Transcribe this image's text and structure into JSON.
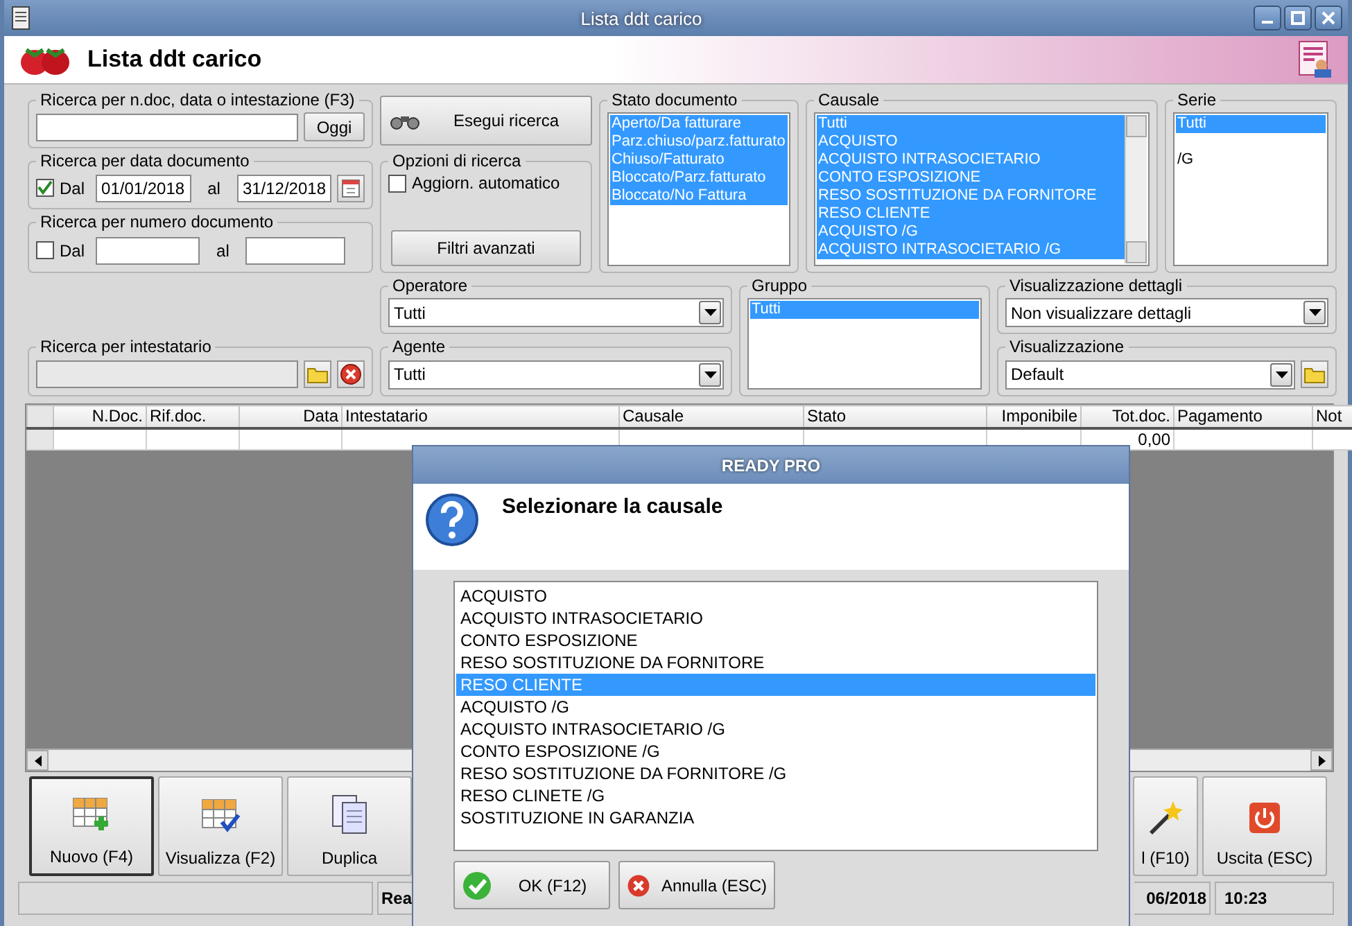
{
  "window": {
    "title": "Lista ddt carico"
  },
  "header": {
    "title": "Lista ddt carico"
  },
  "filters": {
    "search": {
      "legend": "Ricerca per n.doc, data o intestazione (F3)",
      "button": "Oggi"
    },
    "run_button": "Esegui ricerca",
    "date_range": {
      "legend": "Ricerca per data documento",
      "checked": true,
      "from_label": "Dal",
      "from": "01/01/2018",
      "to_label": "al",
      "to": "31/12/2018"
    },
    "number_range": {
      "legend": "Ricerca per numero documento",
      "checked": false,
      "from_label": "Dal",
      "to_label": "al"
    },
    "options": {
      "legend": "Opzioni di ricerca",
      "auto_update": {
        "label": "Aggiorn. automatico",
        "checked": false
      },
      "advanced_button": "Filtri avanzati"
    },
    "stato": {
      "legend": "Stato documento",
      "items": [
        {
          "label": "Aperto/Da fatturare",
          "selected": true
        },
        {
          "label": "Parz.chiuso/parz.fatturato",
          "selected": true
        },
        {
          "label": "Chiuso/Fatturato",
          "selected": true
        },
        {
          "label": "Bloccato/Parz.fatturato",
          "selected": true
        },
        {
          "label": "Bloccato/No Fattura",
          "selected": true
        }
      ]
    },
    "causale": {
      "legend": "Causale",
      "items": [
        {
          "label": "Tutti",
          "selected": true
        },
        {
          "label": "ACQUISTO",
          "selected": true
        },
        {
          "label": "ACQUISTO INTRASOCIETARIO",
          "selected": true
        },
        {
          "label": "CONTO ESPOSIZIONE",
          "selected": true
        },
        {
          "label": "RESO SOSTITUZIONE DA FORNITORE",
          "selected": true
        },
        {
          "label": "RESO CLIENTE",
          "selected": true
        },
        {
          "label": "ACQUISTO /G",
          "selected": true
        },
        {
          "label": "ACQUISTO INTRASOCIETARIO /G",
          "selected": true
        }
      ]
    },
    "serie": {
      "legend": "Serie",
      "items": [
        {
          "label": "Tutti",
          "selected": true
        },
        {
          "label": "/G",
          "selected": false
        }
      ]
    },
    "operatore": {
      "legend": "Operatore",
      "value": "Tutti"
    },
    "gruppo": {
      "legend": "Gruppo",
      "items": [
        {
          "label": "Tutti",
          "selected": true
        }
      ]
    },
    "dettagli": {
      "legend": "Visualizzazione dettagli",
      "value": "Non visualizzare dettagli"
    },
    "intestatario": {
      "legend": "Ricerca per intestatario"
    },
    "agente": {
      "legend": "Agente",
      "value": "Tutti"
    },
    "visualizzazione": {
      "legend": "Visualizzazione",
      "value": "Default"
    }
  },
  "table": {
    "columns": [
      "N.Doc.",
      "Rif.doc.",
      "Data",
      "Intestatario",
      "Causale",
      "Stato",
      "Imponibile",
      "Tot.doc.",
      "Pagamento",
      "Not"
    ],
    "rows": [
      {
        "total": "0,00"
      }
    ]
  },
  "actions": [
    {
      "kind": "new",
      "label": "Nuovo (F4)",
      "selected": true
    },
    {
      "kind": "view",
      "label": "Visualizza (F2)",
      "selected": false
    },
    {
      "kind": "duplicate",
      "label": "Duplica",
      "selected": false
    },
    {
      "kind": "gap"
    },
    {
      "kind": "wand",
      "label": "l (F10)",
      "selected": false
    },
    {
      "kind": "exit",
      "label": "Uscita (ESC)",
      "selected": false
    }
  ],
  "status_bar": {
    "fields": [
      "Rea",
      "06/2018",
      "10:23"
    ]
  },
  "dialog": {
    "title": "READY PRO",
    "message": "Selezionare la causale",
    "items": [
      {
        "label": "ACQUISTO",
        "selected": false
      },
      {
        "label": "ACQUISTO INTRASOCIETARIO",
        "selected": false
      },
      {
        "label": "CONTO ESPOSIZIONE",
        "selected": false
      },
      {
        "label": "RESO SOSTITUZIONE DA FORNITORE",
        "selected": false
      },
      {
        "label": "RESO CLIENTE",
        "selected": true
      },
      {
        "label": "ACQUISTO /G",
        "selected": false
      },
      {
        "label": "ACQUISTO INTRASOCIETARIO /G",
        "selected": false
      },
      {
        "label": "CONTO ESPOSIZIONE /G",
        "selected": false
      },
      {
        "label": "RESO SOSTITUZIONE DA FORNITORE /G",
        "selected": false
      },
      {
        "label": "RESO CLINETE /G",
        "selected": false
      },
      {
        "label": "SOSTITUZIONE IN GARANZIA",
        "selected": false
      }
    ],
    "buttons": [
      {
        "kind": "ok",
        "label": "OK (F12)"
      },
      {
        "kind": "cancel",
        "label": "Annulla (ESC)"
      }
    ]
  }
}
